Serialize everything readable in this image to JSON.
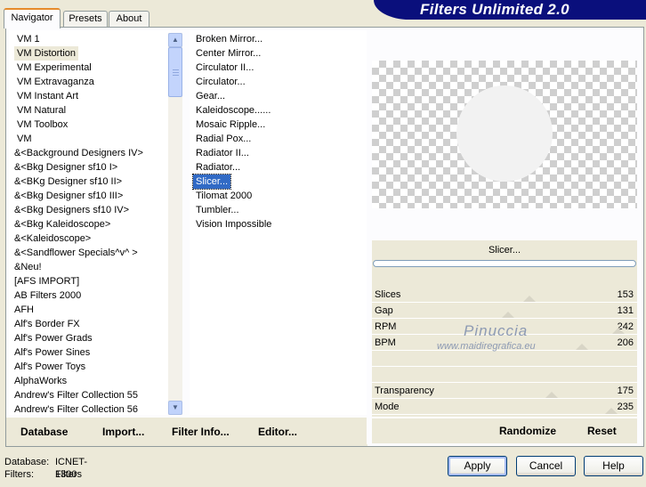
{
  "banner": {
    "title": "Filters Unlimited 2.0"
  },
  "tabs": [
    {
      "label": "Navigator",
      "active": true
    },
    {
      "label": "Presets",
      "active": false
    },
    {
      "label": "About",
      "active": false
    }
  ],
  "categories": [
    "VM 1",
    "VM Distortion",
    "VM Experimental",
    "VM Extravaganza",
    "VM Instant Art",
    "VM Natural",
    "VM Toolbox",
    "VM",
    "&<Background Designers IV>",
    "&<Bkg Designer sf10 I>",
    "&<BKg Designer sf10 II>",
    "&<Bkg Designer sf10 III>",
    "&<Bkg Designers sf10 IV>",
    "&<Bkg Kaleidoscope>",
    "&<Kaleidoscope>",
    "&<Sandflower Specials^v^ >",
    "&Neu!",
    "[AFS IMPORT]",
    "AB Filters 2000",
    "AFH",
    "Alf's Border FX",
    "Alf's Power Grads",
    "Alf's Power Sines",
    "Alf's Power Toys",
    "AlphaWorks",
    "Andrew's Filter Collection 55",
    "Andrew's Filter Collection 56"
  ],
  "selected_category": "VM Distortion",
  "filters": [
    "Broken Mirror...",
    "Center Mirror...",
    "Circulator II...",
    "Circulator...",
    "Gear...",
    "Kaleidoscope......",
    "Mosaic Ripple...",
    "Radial Pox...",
    "Radiator II...",
    "Radiator...",
    "Slicer...",
    "Tilomat 2000",
    "Tumbler...",
    "Vision Impossible"
  ],
  "selected_filter": "Slicer...",
  "left_buttons": {
    "database": "Database",
    "import": "Import...",
    "filter_info": "Filter Info...",
    "editor": "Editor..."
  },
  "preview": {
    "filter_name": "Slicer...",
    "progress": 0
  },
  "parameters": [
    {
      "label": "Slices",
      "value": "153",
      "level": 0.6
    },
    {
      "label": "Gap",
      "value": "131",
      "level": 0.514
    },
    {
      "label": "RPM",
      "value": "242",
      "level": 0.949
    },
    {
      "label": "BPM",
      "value": "206",
      "level": 0.808
    },
    {
      "label": "",
      "value": "",
      "level": null
    },
    {
      "label": "",
      "value": "",
      "level": null
    },
    {
      "label": "Transparency",
      "value": "175",
      "level": 0.686
    },
    {
      "label": "Mode",
      "value": "235",
      "level": 0.922
    }
  ],
  "watermark": {
    "name": "Pinuccia",
    "url": "www.maidiregrafica.eu"
  },
  "right_buttons": {
    "randomize": "Randomize",
    "reset": "Reset"
  },
  "status": {
    "database_label": "Database:",
    "database_value": "ICNET-Filters",
    "filters_label": "Filters:",
    "filters_value": "1300"
  },
  "dialog_buttons": {
    "apply": "Apply",
    "cancel": "Cancel",
    "help": "Help"
  },
  "colors": {
    "banner": "#0a0f7c",
    "selection": "#316ac5",
    "face": "#ece9d8"
  }
}
